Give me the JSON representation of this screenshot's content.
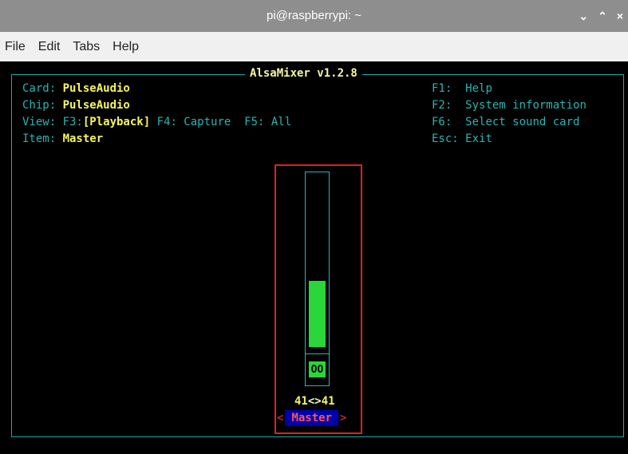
{
  "window": {
    "title": "pi@raspberrypi: ~",
    "controls": [
      "⌄",
      "⌃",
      "×"
    ]
  },
  "menu": {
    "items": [
      "File",
      "Edit",
      "Tabs",
      "Help"
    ]
  },
  "mixer": {
    "title": "AlsaMixer v1.2.8",
    "card_label": "Card: ",
    "card_value": "PulseAudio",
    "chip_label": "Chip: ",
    "chip_value": "PulseAudio",
    "view_label": "View: F3:",
    "view_active": "[Playback]",
    "view_rest": " F4: Capture  F5: All",
    "item_label": "Item: ",
    "item_value": "Master",
    "help": [
      {
        "key": "F1:",
        "text": "Help"
      },
      {
        "key": "F2:",
        "text": "System information"
      },
      {
        "key": "F6:",
        "text": "Select sound card"
      },
      {
        "key": "Esc:",
        "text": "Exit"
      }
    ],
    "control": {
      "name": "Master",
      "left_level": "41",
      "right_level": "41",
      "arrows": "<>",
      "mute": "OO",
      "volume_fraction": 0.38,
      "chevron_left": "<",
      "chevron_right": ">"
    }
  },
  "colors": {
    "accent": "#2ab3b3",
    "value": "#f5f55f",
    "fader": "#2bd63a",
    "highlight": "#e02020"
  }
}
